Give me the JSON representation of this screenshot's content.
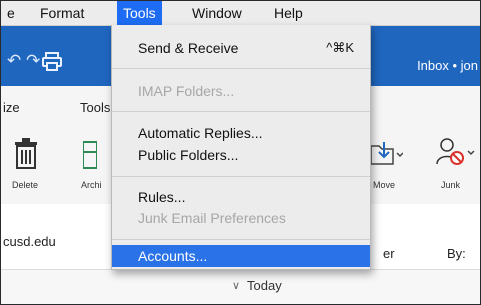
{
  "menubar": {
    "items": [
      {
        "label": "e"
      },
      {
        "label": "Format"
      },
      {
        "label": "Tools"
      },
      {
        "label": "Window"
      },
      {
        "label": "Help"
      }
    ]
  },
  "titlebar": {
    "undo_icon": "undo-icon",
    "redo_icon": "redo-icon",
    "print_icon": "print-icon",
    "title": "Inbox • jon"
  },
  "ribbon_tabs": {
    "items": [
      "ize",
      "Tools"
    ]
  },
  "ribbon": {
    "delete_label": "Delete",
    "archive_label": "Archi",
    "move_label": "Move",
    "junk_label": "Junk"
  },
  "account_row": {
    "email": "cusd.edu",
    "sender_label": "er",
    "by_label": "By:"
  },
  "today": {
    "chevron": "∨",
    "label": "Today"
  },
  "tools_menu": {
    "items": [
      {
        "label": "Send & Receive",
        "shortcut": "^⌘K",
        "enabled": true
      },
      {
        "label": "IMAP Folders...",
        "enabled": false
      },
      {
        "label": "Automatic Replies...",
        "enabled": true
      },
      {
        "label": "Public Folders...",
        "enabled": true
      },
      {
        "label": "Rules...",
        "enabled": true
      },
      {
        "label": "Junk Email Preferences",
        "enabled": false
      },
      {
        "label": "Accounts...",
        "enabled": true,
        "selected": true
      }
    ]
  },
  "colors": {
    "outlook_blue": "#1f66bf",
    "menu_highlight": "#2a72e8",
    "disabled_text": "#a6a6a6"
  }
}
